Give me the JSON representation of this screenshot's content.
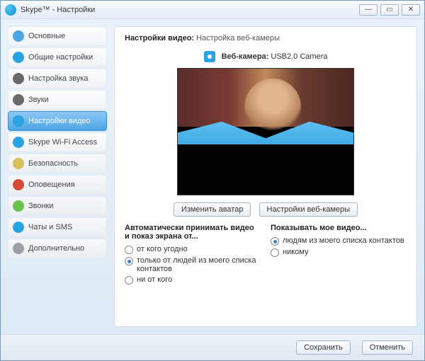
{
  "title": "Skype™ - Настройки",
  "sidebar": {
    "items": [
      {
        "label": "Основные",
        "color": "#4aa6e4"
      },
      {
        "label": "Общие настройки",
        "color": "#2aa3e0"
      },
      {
        "label": "Настройка звука",
        "color": "#6a6a6a"
      },
      {
        "label": "Звуки",
        "color": "#6a6a6a"
      },
      {
        "label": "Настройки видео",
        "color": "#2aa3e0"
      },
      {
        "label": "Skype Wi-Fi Access",
        "color": "#2aa3e0"
      },
      {
        "label": "Безопасность",
        "color": "#d9c05a"
      },
      {
        "label": "Оповещения",
        "color": "#d84b3a"
      },
      {
        "label": "Звонки",
        "color": "#6ac24b"
      },
      {
        "label": "Чаты и SMS",
        "color": "#2aa3e0"
      },
      {
        "label": "Дополнительно",
        "color": "#9aa0a6"
      }
    ]
  },
  "main": {
    "header_bold": "Настройки видео:",
    "header_rest": "Настройка веб-камеры",
    "webcam_label": "Веб-камера:",
    "webcam_name": "USB2.0 Camera",
    "change_avatar": "Изменить аватар",
    "webcam_settings": "Настройки веб-камеры",
    "left_heading": "Автоматически принимать видео и показ экрана от...",
    "right_heading": "Показывать мое видео...",
    "left_options": [
      {
        "label": "от кого угодно",
        "checked": false
      },
      {
        "label": "только от людей из моего списка контактов",
        "checked": true
      },
      {
        "label": "ни от кого",
        "checked": false
      }
    ],
    "right_options": [
      {
        "label": "людям из моего списка контактов",
        "checked": true
      },
      {
        "label": "никому",
        "checked": false
      }
    ]
  },
  "footer": {
    "save": "Сохранить",
    "cancel": "Отменить"
  }
}
